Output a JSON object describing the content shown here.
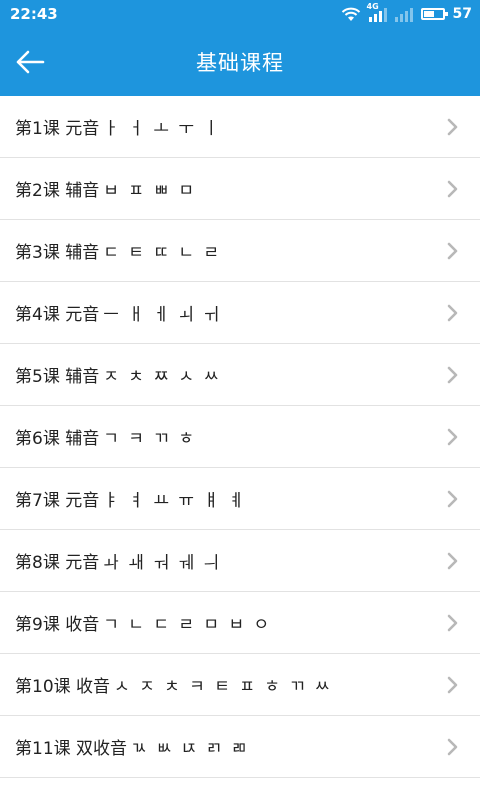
{
  "status_bar": {
    "time": "22:43",
    "network_tag": "4G",
    "battery_percent": "57",
    "battery_level": 0.57
  },
  "header": {
    "title": "基础课程",
    "back_icon": "arrow-left-icon"
  },
  "lessons": [
    {
      "label": "第1课 元音",
      "letters": "ㅏ ㅓ ㅗ ㅜ ㅣ"
    },
    {
      "label": "第2课 辅音",
      "letters": "ㅂ ㅍ ㅃ ㅁ"
    },
    {
      "label": "第3课 辅音",
      "letters": "ㄷ ㅌ ㄸ ㄴ ㄹ"
    },
    {
      "label": "第4课 元音",
      "letters": "ㅡ ㅐ ㅔ ㅚ ㅟ"
    },
    {
      "label": "第5课 辅音",
      "letters": "ㅈ ㅊ ㅉ ㅅ ㅆ"
    },
    {
      "label": "第6课 辅音",
      "letters": "ㄱ ㅋ ㄲ ㅎ"
    },
    {
      "label": "第7课 元音",
      "letters": "ㅑ ㅕ ㅛ ㅠ ㅒ ㅖ"
    },
    {
      "label": "第8课 元音",
      "letters": "ㅘ ㅙ ㅝ ㅞ ㅢ"
    },
    {
      "label": "第9课 收音",
      "letters": "ㄱ ㄴ ㄷ ㄹ ㅁ ㅂ ㅇ"
    },
    {
      "label": "第10课 收音",
      "letters": "ㅅ ㅈ ㅊ ㅋ ㅌ ㅍ ㅎ ㄲ ㅆ"
    },
    {
      "label": "第11课 双收音",
      "letters": "ㄳ ㅄ ㄵ ㄺ ㄻ"
    }
  ],
  "colors": {
    "primary": "#1e95dd",
    "divider": "#e2e2e2",
    "chevron": "#b8b8b8"
  }
}
